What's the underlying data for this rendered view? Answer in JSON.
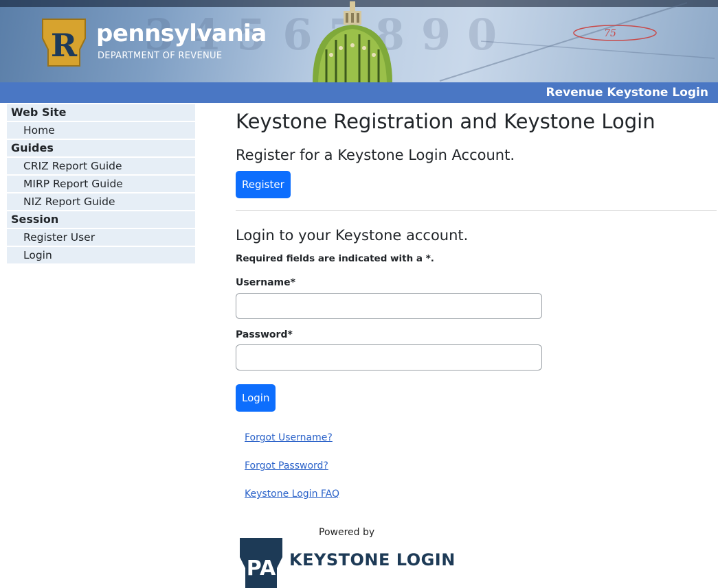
{
  "banner": {
    "state_name": "pennsylvania",
    "department": "DEPARTMENT OF REVENUE",
    "background_digits": "34567890",
    "route_sign": "75",
    "logo_letter": "R"
  },
  "title_bar": {
    "title": "Revenue Keystone Login"
  },
  "sidebar": {
    "sections": [
      {
        "heading": "Web Site",
        "items": [
          "Home"
        ]
      },
      {
        "heading": "Guides",
        "items": [
          "CRIZ Report Guide",
          "MIRP Report Guide",
          "NIZ Report Guide"
        ]
      },
      {
        "heading": "Session",
        "items": [
          "Register User",
          "Login"
        ]
      }
    ]
  },
  "main": {
    "page_title": "Keystone Registration and Keystone Login",
    "register_heading": "Register for a Keystone Login Account.",
    "register_button": "Register",
    "login_heading": "Login to your Keystone account.",
    "required_note": "Required fields are indicated with a *.",
    "username_label": "Username*",
    "username_value": "",
    "password_label": "Password*",
    "password_value": "",
    "login_button": "Login",
    "links": [
      "Forgot Username?",
      "Forgot Password?",
      "Keystone Login FAQ"
    ],
    "powered_by": "Powered by",
    "badge_pa": "PA",
    "badge_text": "KEYSTONE LOGIN"
  },
  "colors": {
    "title_bar": "#4a77c4",
    "primary_button": "#0d6efd",
    "sidebar_bg": "#e6eef6",
    "link": "#2a62c9",
    "keystone_navy": "#1d3a56",
    "logo_gold": "#d7a32e"
  }
}
